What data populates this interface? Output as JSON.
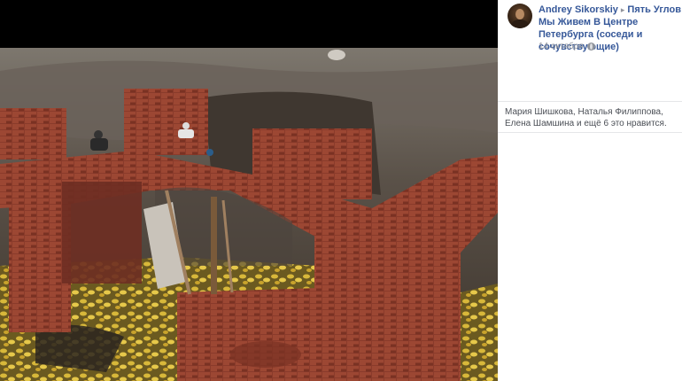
{
  "post": {
    "author": "Andrey Sikorskiy",
    "separator": "▸",
    "group": "Пять Углов: Мы Живем В Центре Петербурга (соседи и сочувствующие)",
    "date": "14 октября",
    "privacy_icon": "globe-icon"
  },
  "reactions": {
    "text": "Мария Шишкова, Наталья Филиппова, Елена Шамшина и ещё 6 это нравится."
  },
  "photo": {
    "subject": "excavation-brick-ruins",
    "colors": {
      "brick": "#8a3b2b",
      "soil": "#5a5148",
      "leaves": "#d4b33a"
    }
  }
}
